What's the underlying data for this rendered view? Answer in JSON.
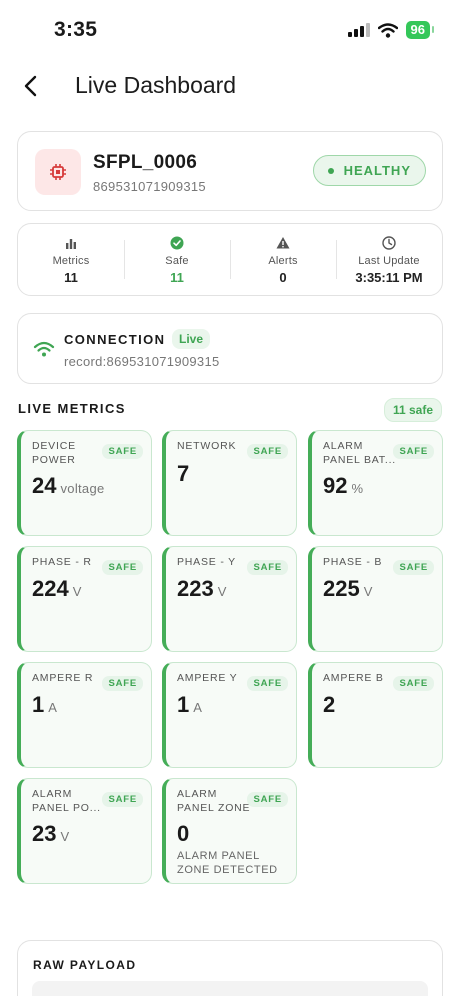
{
  "status_bar": {
    "time": "3:35",
    "battery": "96"
  },
  "header": {
    "title": "Live Dashboard"
  },
  "device": {
    "name": "SFPL_0006",
    "id": "869531071909315",
    "status": "HEALTHY"
  },
  "summary": [
    {
      "label": "Metrics",
      "value": "11",
      "icon": "bar-chart-icon"
    },
    {
      "label": "Safe",
      "value": "11",
      "icon": "check-circle-icon"
    },
    {
      "label": "Alerts",
      "value": "0",
      "icon": "warning-icon"
    },
    {
      "label": "Last Update",
      "value": "3:35:11 PM",
      "icon": "clock-icon"
    }
  ],
  "connection": {
    "title": "CONNECTION",
    "badge": "Live",
    "record": "record:869531071909315"
  },
  "live_metrics": {
    "title": "LIVE METRICS",
    "safe_count": "11 safe"
  },
  "metrics": [
    {
      "label": "DEVICE\nPOWER",
      "badge": "SAFE",
      "value": "24",
      "unit": "voltage"
    },
    {
      "label": "NETWORK",
      "badge": "SAFE",
      "value": "7",
      "unit": ""
    },
    {
      "label": "ALARM\nPANEL BAT...",
      "badge": "SAFE",
      "value": "92",
      "unit": "%"
    },
    {
      "label": "PHASE - R",
      "badge": "SAFE",
      "value": "224",
      "unit": "V"
    },
    {
      "label": "PHASE - Y",
      "badge": "SAFE",
      "value": "223",
      "unit": "V"
    },
    {
      "label": "PHASE - B",
      "badge": "SAFE",
      "value": "225",
      "unit": "V"
    },
    {
      "label": "AMPERE R",
      "badge": "SAFE",
      "value": "1",
      "unit": "A"
    },
    {
      "label": "AMPERE Y",
      "badge": "SAFE",
      "value": "1",
      "unit": "A"
    },
    {
      "label": "AMPERE B",
      "badge": "SAFE",
      "value": "2",
      "unit": ""
    },
    {
      "label": "ALARM\nPANEL PO...",
      "badge": "SAFE",
      "value": "23",
      "unit": "V"
    },
    {
      "label": "ALARM\nPANEL ZONE",
      "badge": "SAFE",
      "value": "0",
      "unit": "",
      "desc": "ALARM PANEL ZONE DETECTED"
    }
  ],
  "raw_payload": {
    "title": "RAW PAYLOAD"
  },
  "colors": {
    "accent": "#3fa553",
    "device_icon_bg": "#fde7e7",
    "device_icon": "#d63a3a"
  }
}
